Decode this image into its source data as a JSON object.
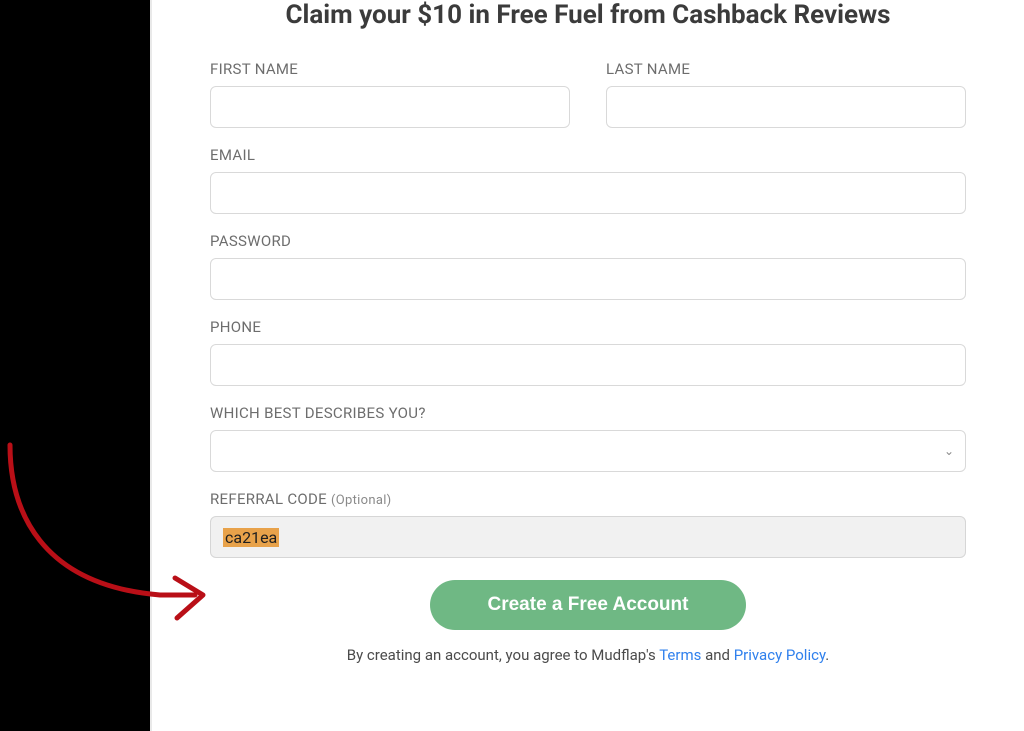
{
  "title": "Claim your $10 in Free Fuel from Cashback Reviews",
  "form": {
    "first_name": {
      "label": "FIRST NAME",
      "value": ""
    },
    "last_name": {
      "label": "LAST NAME",
      "value": ""
    },
    "email": {
      "label": "EMAIL",
      "value": ""
    },
    "password": {
      "label": "PASSWORD",
      "value": ""
    },
    "phone": {
      "label": "PHONE",
      "value": ""
    },
    "describe": {
      "label": "WHICH BEST DESCRIBES YOU?",
      "value": ""
    },
    "referral": {
      "label": "REFERRAL CODE ",
      "hint": "(Optional)",
      "value": "ca21ea"
    },
    "submit_label": "Create a Free Account"
  },
  "agree": {
    "prefix": "By creating an account, you agree to Mudflap's ",
    "terms": "Terms",
    "sep": " and ",
    "privacy": "Privacy Policy",
    "suffix": "."
  },
  "annotation": {
    "arrow_color": "#b90f17"
  }
}
